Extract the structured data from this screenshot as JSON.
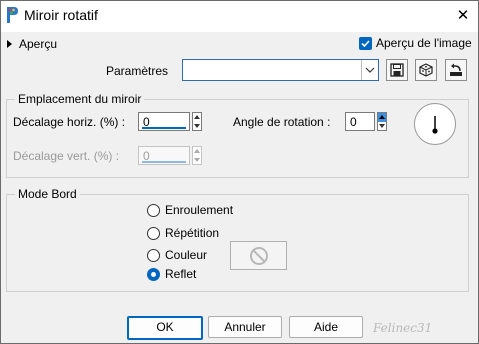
{
  "window": {
    "title": "Miroir rotatif",
    "close_glyph": "✕"
  },
  "preview": {
    "toggle_label": "Aperçu",
    "checkbox_label": "Aperçu de l'image",
    "checked": true
  },
  "params": {
    "label": "Paramètres",
    "value": "",
    "buttons": [
      "save-preset-icon",
      "random-dice-icon",
      "reset-default-icon"
    ]
  },
  "mirror_group": {
    "title": "Emplacement du miroir",
    "horiz_label": "Décalage horiz. (%) :",
    "horiz_value": "0",
    "vert_label": "Décalage vert. (%) :",
    "vert_value": "0",
    "vert_enabled": false,
    "angle_label": "Angle de rotation :",
    "angle_value": "0"
  },
  "edge_group": {
    "title": "Mode Bord",
    "options": [
      "Enroulement",
      "Répétition",
      "Couleur",
      "Reflet"
    ],
    "selected": "Reflet"
  },
  "buttons": {
    "ok": "OK",
    "cancel": "Annuler",
    "help": "Aide"
  },
  "watermark": "Felinec31",
  "colors": {
    "accent": "#0067c0",
    "window_bg": "#f0f0f0"
  }
}
